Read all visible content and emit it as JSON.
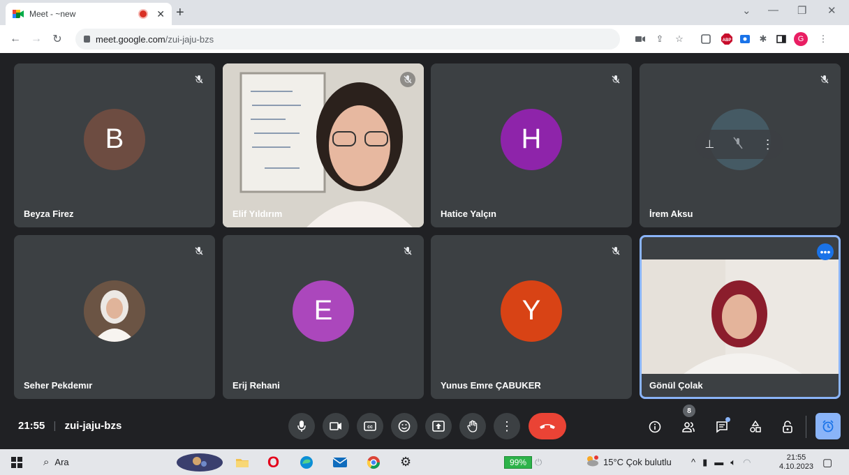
{
  "browser": {
    "tab_title": "Meet - ~new",
    "url_host": "meet.google.com",
    "url_path": "/zui-jaju-bzs",
    "profile_initial": "G",
    "abp_label": "ABP"
  },
  "participants": [
    {
      "name": "Beyza Firez",
      "initial": "B",
      "avatar_color": "#6d4c41",
      "muted": true
    },
    {
      "name": "Elif Yıldırım",
      "initial": "",
      "avatar_color": "",
      "muted": true,
      "video": true
    },
    {
      "name": "Hatice Yalçın",
      "initial": "H",
      "avatar_color": "#8e24aa",
      "muted": true
    },
    {
      "name": "İrem Aksu",
      "initial": "",
      "avatar_color": "#455a64",
      "muted": true
    },
    {
      "name": "Seher Pekdemır",
      "initial": "",
      "avatar_color": "",
      "muted": true,
      "photo": true
    },
    {
      "name": "Erij Rehani",
      "initial": "E",
      "avatar_color": "#ab47bc",
      "muted": true
    },
    {
      "name": "Yunus Emre ÇABUKER",
      "initial": "Y",
      "avatar_color": "#d84315",
      "muted": true
    },
    {
      "name": "Gönül Çolak",
      "initial": "",
      "avatar_color": "",
      "muted": false,
      "video": true,
      "self": true
    }
  ],
  "meeting": {
    "time": "21:55",
    "code": "zui-jaju-bzs",
    "people_count": "8"
  },
  "taskbar": {
    "search_label": "Ara",
    "battery": "99%",
    "weather": "15°C Çok bulutlu",
    "clock_time": "21:55",
    "clock_date": "4.10.2023"
  },
  "colors": {
    "accent": "#8ab4f8",
    "end_call": "#ea4335",
    "stage_bg": "#202124",
    "tile_bg": "#3c4043"
  }
}
